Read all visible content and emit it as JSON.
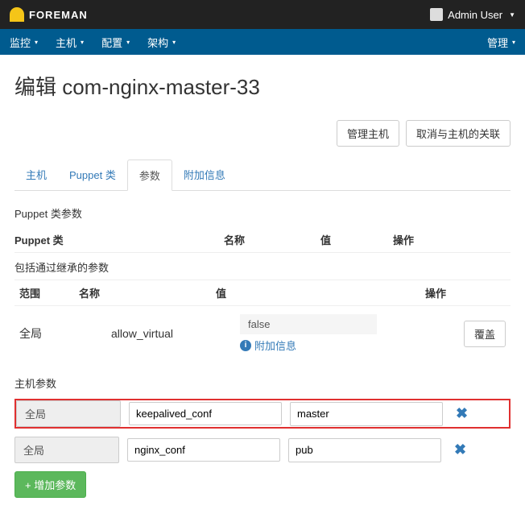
{
  "topbar": {
    "brand": "FOREMAN",
    "user": "Admin User"
  },
  "menubar": {
    "left": [
      "监控",
      "主机",
      "配置",
      "架构"
    ],
    "right": [
      "管理"
    ]
  },
  "page_title": "编辑 com-nginx-master-33",
  "actions": {
    "manage_host": "管理主机",
    "unassociate": "取消与主机的关联"
  },
  "tabs": [
    {
      "label": "主机",
      "active": false
    },
    {
      "label": "Puppet 类",
      "active": false
    },
    {
      "label": "参数",
      "active": true
    },
    {
      "label": "附加信息",
      "active": false
    }
  ],
  "puppet_section": {
    "title": "Puppet 类参数",
    "headers": {
      "class": "Puppet 类",
      "name": "名称",
      "value": "值",
      "action": "操作"
    },
    "inherited_title": "包括通过继承的参数",
    "headers2": {
      "scope": "范围",
      "name": "名称",
      "value": "值",
      "action": "操作"
    },
    "row": {
      "scope": "全局",
      "name": "allow_virtual",
      "value": "false",
      "info": "附加信息",
      "override": "覆盖"
    }
  },
  "host_params": {
    "title": "主机参数",
    "rows": [
      {
        "scope": "全局",
        "name": "keepalived_conf",
        "value": "master",
        "highlighted": true
      },
      {
        "scope": "全局",
        "name": "nginx_conf",
        "value": "pub",
        "highlighted": false
      }
    ],
    "add_label": "+ 增加参数"
  }
}
